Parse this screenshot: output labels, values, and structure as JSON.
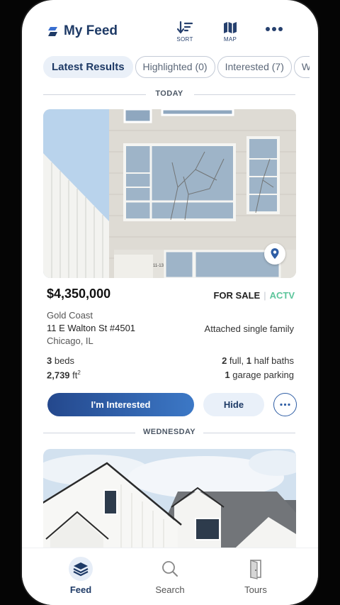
{
  "header": {
    "title": "My Feed",
    "sort_label": "SORT",
    "map_label": "MAP"
  },
  "tabs": [
    {
      "label": "Latest Results"
    },
    {
      "label": "Highlighted (0)"
    },
    {
      "label": "Interested (7)"
    },
    {
      "label": "Wit"
    }
  ],
  "sections": [
    {
      "label": "TODAY"
    },
    {
      "label": "WEDNESDAY"
    }
  ],
  "listing": {
    "price": "$4,350,000",
    "status": "FOR SALE",
    "status_code": "ACTV",
    "neighborhood": "Gold Coast",
    "address": "11 E Walton St #4501",
    "city": "Chicago, IL",
    "property_type": "Attached single family",
    "beds_num": "3",
    "beds_label": " beds",
    "sqft_num": "2,739",
    "sqft_unit": " ft",
    "sqft_sup": "2",
    "full_baths_num": "2",
    "full_baths_label": " full, ",
    "half_baths_num": "1",
    "half_baths_label": " half baths",
    "garage_num": "1",
    "garage_label": " garage parking",
    "interested_label": "I'm Interested",
    "hide_label": "Hide"
  },
  "nav": [
    {
      "label": "Feed"
    },
    {
      "label": "Search"
    },
    {
      "label": "Tours"
    }
  ],
  "colors": {
    "brand": "#1e3a66",
    "accent": "#2f5ea5",
    "active_status": "#5cc59b"
  }
}
